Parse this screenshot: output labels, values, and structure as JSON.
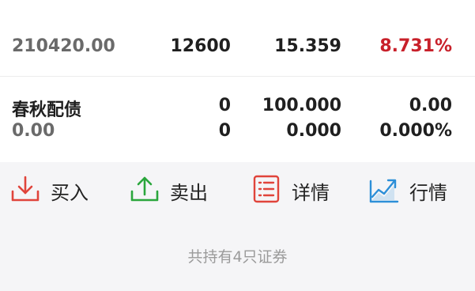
{
  "top_row": {
    "col1": "210420.00",
    "col2": "12600",
    "col3": "15.359",
    "col4": "8.731%"
  },
  "holding": {
    "name": "春秋配债",
    "row1_col2": "0",
    "row1_col3": "100.000",
    "row1_col4": "0.00",
    "row2_col1": "0.00",
    "row2_col2": "0",
    "row2_col3": "0.000",
    "row2_col4": "0.000%"
  },
  "actions": [
    {
      "label": "买入",
      "icon": "download-icon",
      "color": "#e0443b"
    },
    {
      "label": "卖出",
      "icon": "upload-icon",
      "color": "#2aa63c"
    },
    {
      "label": "详情",
      "icon": "list-icon",
      "color": "#e0443b"
    },
    {
      "label": "行情",
      "icon": "trend-chart-icon",
      "color": "#2d8fd8"
    }
  ],
  "footer": {
    "summary": "共持有4只证券"
  }
}
